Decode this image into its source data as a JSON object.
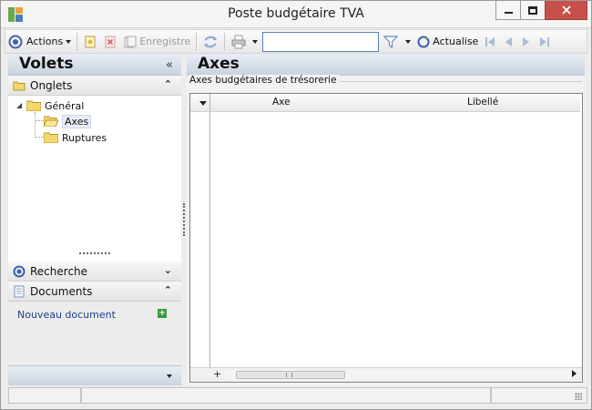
{
  "window": {
    "title": "Poste budgétaire TVA",
    "accent": "#5a7fc4",
    "close_color": "#c7504a"
  },
  "toolbar": {
    "actions_label": "Actions",
    "new_icon": "new-document-icon",
    "delete_icon": "delete-icon",
    "save_label": "Enregistre",
    "refresh_icon": "refresh-icon",
    "print_icon": "print-icon",
    "search_value": "",
    "filter_icon": "filter-icon",
    "actualise_label": "Actualise",
    "nav_icons": [
      "first-record-icon",
      "previous-record-icon",
      "next-record-icon",
      "last-record-icon"
    ]
  },
  "left_panel": {
    "title": "Volets",
    "onglets": {
      "label": "Onglets",
      "tree": {
        "root": "Général",
        "children": [
          "Axes",
          "Ruptures"
        ],
        "selected": "Axes"
      }
    },
    "recherche": {
      "label": "Recherche"
    },
    "documents": {
      "label": "Documents",
      "new_link": "Nouveau document"
    }
  },
  "main": {
    "title": "Axes",
    "group_label": "Axes budgétaires de trésorerie",
    "grid": {
      "columns": [
        "Axe",
        "Libellé"
      ],
      "rows": []
    }
  }
}
